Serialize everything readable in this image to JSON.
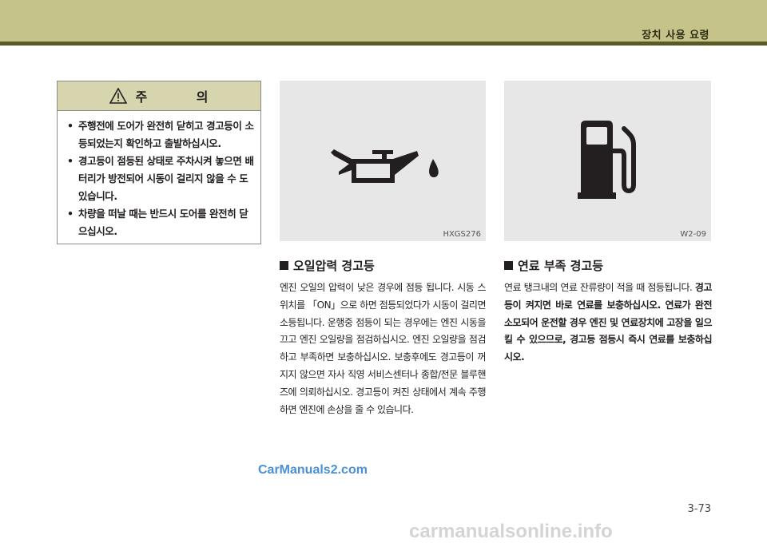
{
  "header": {
    "title": "장치 사용 요령"
  },
  "caution": {
    "title": "주 의",
    "items": [
      "주행전에 도어가 완전히 닫히고 경고등이 소등되었는지 확인하고 출발하십시오.",
      "경고등이 점등된 상태로 주차시켜 놓으면 배터리가 방전되어 시동이 걸리지 않을 수 도 있습니다.",
      "차량을 떠날 때는 반드시 도어를 완전히 닫으십시오."
    ]
  },
  "figures": {
    "oil": {
      "code": "HXGS276",
      "icon": "oil-can-icon"
    },
    "fuel": {
      "code": "W2-09",
      "icon": "fuel-pump-icon"
    }
  },
  "sections": {
    "oil": {
      "title": "오일압력 경고등",
      "body": "엔진 오일의 압력이 낮은 경우에 점등 됩니다. 시동 스위치를 「ON」으로 하면 점등되었다가 시동이 걸리면 소등됩니다. 운행중 점등이 되는 경우에는 엔진 시동을 끄고 엔진 오일량을 점검하십시오. 엔진 오일량을 점검하고 부족하면 보충하십시오. 보충후에도 경고등이 꺼지지 않으면 자사 직영 서비스센터나 종합/전문 블루핸즈에 의뢰하십시오. 경고등이 켜진 상태에서 계속 주행하면 엔진에 손상을 줄 수 있습니다."
    },
    "fuel": {
      "title": "연료 부족 경고등",
      "body": "연료 탱크내의 연료 잔류량이 적을 때 점등됩니다.",
      "body_bold": "경고등이 켜지면 바로 연료를 보충하십시오. 연료가 완전 소모되어 운전할 경우 엔진 및 연료장치에 고장을 일으킬 수 있으므로, 경고등 점등시 즉시 연료를 보충하십시오."
    }
  },
  "watermarks": {
    "carmanuals": "CarManuals2.com",
    "site": "carmanualsonline.info"
  },
  "page": {
    "number": "3-73"
  },
  "colors": {
    "header_band": "#c5c38a",
    "header_rule": "#5a5a24",
    "caution_head": "#d6d5ae",
    "panel_bg": "#e7e7e8"
  }
}
